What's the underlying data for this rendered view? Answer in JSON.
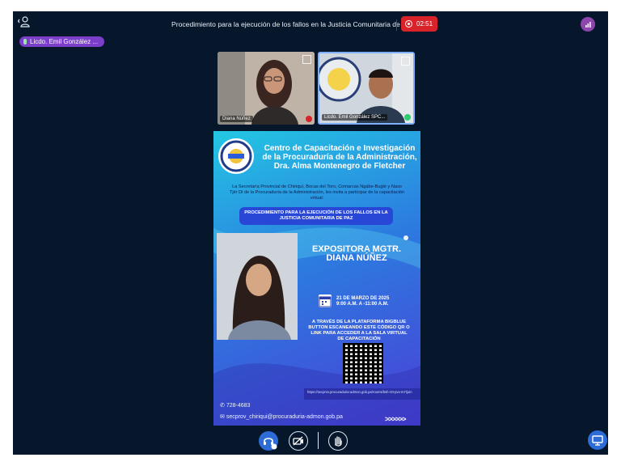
{
  "header": {
    "title": "Procedimiento para la ejecución de los fallos en la Justicia Comunitaria de Paz",
    "recording_time": "02:51"
  },
  "presenter_pill": {
    "label": "Licdo. Emil González ..."
  },
  "video_tiles": [
    {
      "name": "Diana Núñez"
    },
    {
      "name": "Licdo. Emil González SPC..."
    }
  ],
  "poster": {
    "heading": "Centro de Capacitación e Investigación de la Procuraduría de la Administración, Dra. Alma Montenegro de Fletcher",
    "intro": "La Secretaría Provincial de Chiriquí, Bocas del Toro, Comarcas Ngäbe-Buglé y Naso Tjër Di de la Procuraduría de la Administración, les invita a participar de la capacitación virtual:",
    "banner": "PROCEDIMIENTO PARA LA EJECUCIÓN DE LOS FALLOS EN LA JUSTICIA COMUNITARIA DE PAZ",
    "expositora": "EXPOSITORA MGTR. DIANA NÚÑEZ",
    "date": "21 DE MARZO DE 2025",
    "time": "9:00 A.M. A -11:00 A.M.",
    "access": "A TRAVÉS DE LA PLATAFORMA BIGBLUE BUTTON ESCANEANDO ESTE CÓDIGO QR O LINK PARA ACCEDER A LA SALA VIRTUAL DE CAPACITACIÓN",
    "link": "https://secprov.procuraduria-admon.gob.pa/rooms/bsh-r2t-pvx-m7/join",
    "phone": "728-4683",
    "email": "secprov_chiriqui@procuraduria-admon.gob.pa",
    "arrows": ">>>>>>"
  },
  "colors": {
    "recording": "#d8232a",
    "accent": "#2d6bd6",
    "pill": "#7b3fc9"
  }
}
